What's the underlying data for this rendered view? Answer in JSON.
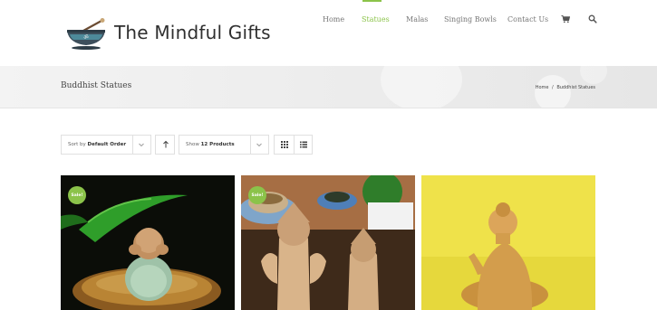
{
  "brand": {
    "name": "The Mindful Gifts"
  },
  "nav": {
    "items": [
      {
        "label": "Home",
        "active": false
      },
      {
        "label": "Statues",
        "active": true
      },
      {
        "label": "Malas",
        "active": false
      },
      {
        "label": "Singing Bowls",
        "active": false
      },
      {
        "label": "Contact Us",
        "active": false
      }
    ],
    "cart_icon": "cart-icon",
    "search_icon": "search-icon",
    "accent_color": "#8bc34a"
  },
  "page": {
    "title": "Buddhist Statues",
    "breadcrumb": [
      "Home",
      "/",
      "Buddhist Statues"
    ]
  },
  "toolbar": {
    "sort_prefix": "Sort by",
    "sort_value": "Default Order",
    "show_prefix": "Show",
    "show_value": "12 Products",
    "sort_direction_icon": "arrow-up-icon",
    "grid_view_icon": "grid-icon",
    "list_view_icon": "list-icon"
  },
  "products": [
    {
      "badge": "Sale!",
      "image": "monk-covering-ears-statue"
    },
    {
      "badge": "Sale!",
      "image": "ganesha-statues-pair"
    },
    {
      "badge": "",
      "image": "golden-buddha-statue"
    }
  ]
}
